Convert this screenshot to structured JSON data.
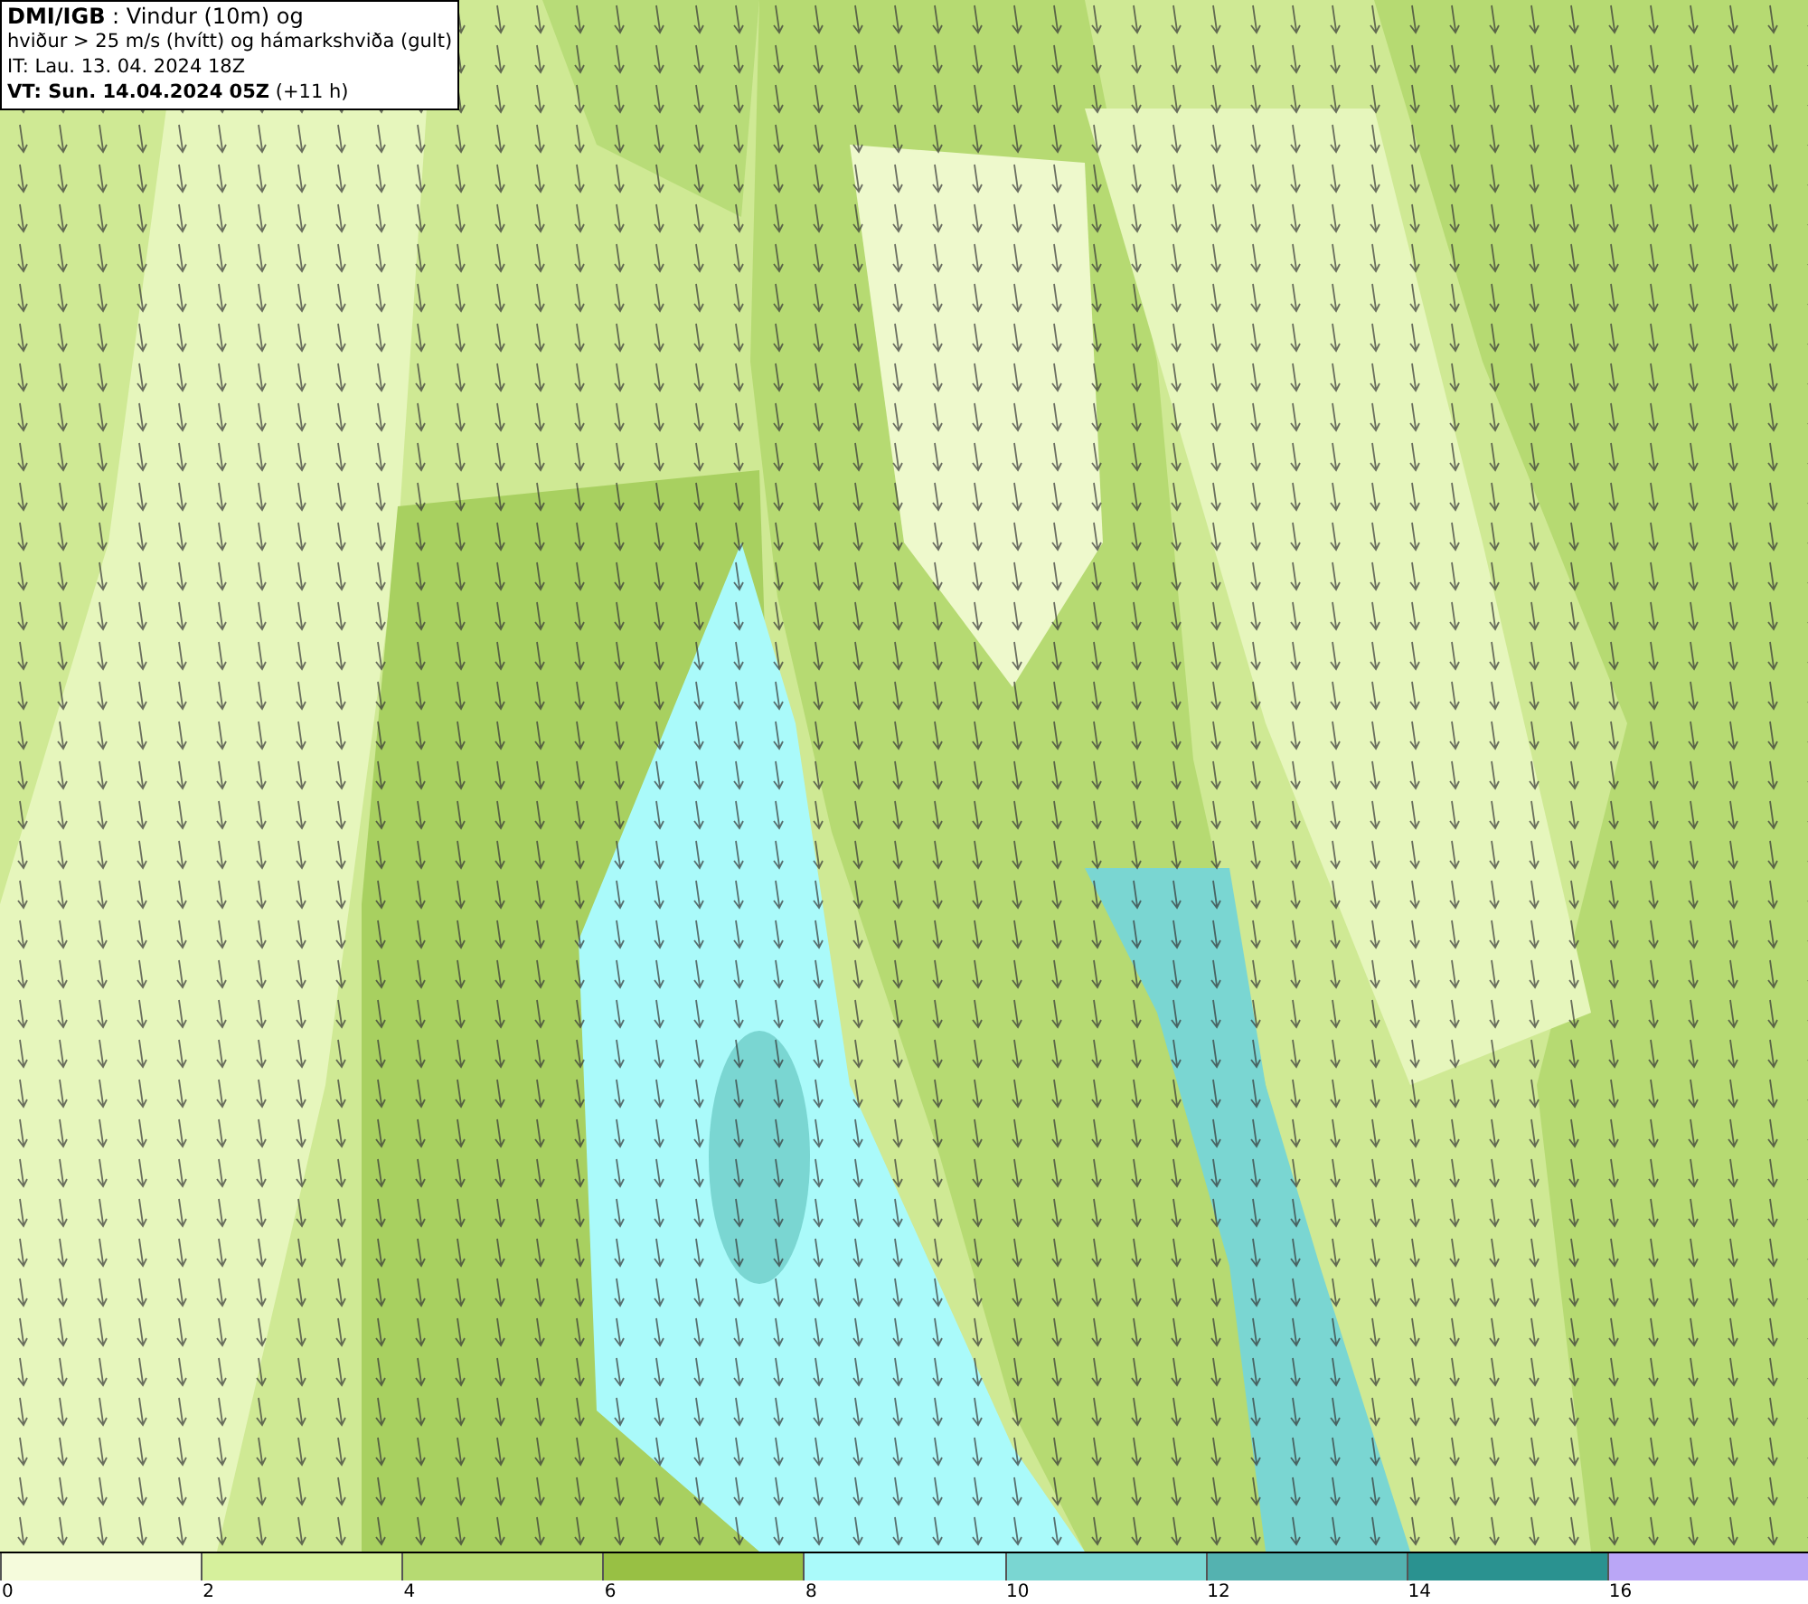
{
  "header": {
    "lines": [
      "**DMI/IGB** : Vindur (10m) og",
      "hviður > 25 m/s (hvítt) og hámarkshviða (gult)",
      "IT: Lau. 13. 04. 2024 18Z",
      "**VT: Sun. 14.04.2024 05Z** (+11 h)"
    ]
  },
  "legend": {
    "segments": [
      {
        "label": "0",
        "color": "#f5fbdc"
      },
      {
        "label": "2",
        "color": "#d6f09c"
      },
      {
        "label": "4",
        "color": "#b6da72"
      },
      {
        "label": "6",
        "color": "#98c044"
      },
      {
        "label": "8",
        "color": "#aafafa"
      },
      {
        "label": "10",
        "color": "#7ad6d2"
      },
      {
        "label": "12",
        "color": "#54b2b0"
      },
      {
        "label": "14",
        "color": "#2a9290"
      },
      {
        "label": "16",
        "color": "#baa6f6"
      }
    ]
  }
}
